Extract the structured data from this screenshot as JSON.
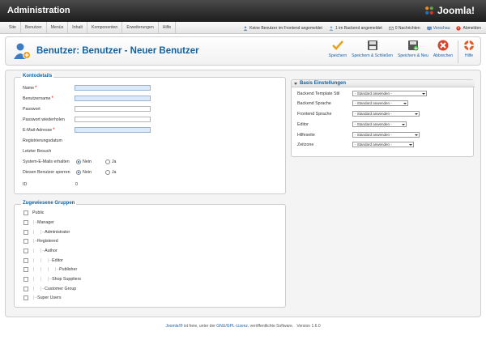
{
  "header": {
    "title": "Administration",
    "logo_text": "Joomla!"
  },
  "menu": [
    "Site",
    "Benutzer",
    "Menüs",
    "Inhalt",
    "Komponenten",
    "Erweiterungen",
    "Hilfe"
  ],
  "status": {
    "frontend": "Keine Benutzer im Frontend angemeldet",
    "backend": "1 im Backend angemeldet",
    "messages": "0 Nachrichten",
    "preview": "Vorschau",
    "logout": "Abmelden"
  },
  "toolbar": {
    "title": "Benutzer: Benutzer - Neuer Benutzer",
    "save": "Speichern",
    "save_close": "Speichern & Schließen",
    "save_new": "Speichern & Neu",
    "cancel": "Abbrechen",
    "help": "Hilfe"
  },
  "account": {
    "legend": "Kontodetails",
    "name": "Name",
    "username": "Benutzername",
    "password": "Passwort",
    "password2": "Passwort wiederholen",
    "email": "E-Mail-Adresse",
    "register_date": "Registrierungsdatum",
    "last_visit": "Letzter Besuch",
    "system_mails": "System-E-Mails erhalten",
    "block_user": "Diesen Benutzer sperren",
    "no": "Nein",
    "yes": "Ja",
    "id_label": "ID",
    "id_value": "0"
  },
  "groups": {
    "legend": "Zugewiesene Gruppen",
    "items": [
      {
        "label": "Public",
        "prefix": ""
      },
      {
        "label": "Manager",
        "prefix": "|—"
      },
      {
        "label": "Administrator",
        "prefix": "|  |—"
      },
      {
        "label": "Registered",
        "prefix": "|—"
      },
      {
        "label": "Author",
        "prefix": "|  |—"
      },
      {
        "label": "Editor",
        "prefix": "|  |  |—"
      },
      {
        "label": "Publisher",
        "prefix": "|  |  |  |—"
      },
      {
        "label": "Shop Suppliers",
        "prefix": "|  |  |—"
      },
      {
        "label": "Customer Group",
        "prefix": "|  |—"
      },
      {
        "label": "Super Users",
        "prefix": "|—"
      }
    ]
  },
  "basis": {
    "legend": "Basis Einstellungen",
    "rows": [
      {
        "label": "Backend Template Stil",
        "value": "- Standard anwenden -"
      },
      {
        "label": "Backend Sprache",
        "value": "- Standard anwenden -"
      },
      {
        "label": "Frontend Sprache",
        "value": "- Standard anwenden -"
      },
      {
        "label": "Editor",
        "value": "- Standard anwenden -"
      },
      {
        "label": "Hilfeseite",
        "value": "- Standard anwenden -"
      },
      {
        "label": "Zeitzone",
        "value": "- Standard anwenden -"
      }
    ]
  },
  "footer": {
    "brand": "Joomla!®",
    "text1": " ist freie, unter der ",
    "license": "GNU/GPL-Lizenz",
    "text2": ", veröffentlichte Software.",
    "version": "Version 1.6.0"
  },
  "colors": {
    "accent": "#14609c",
    "required_field": "#dbe9f8",
    "save": "#e8a11a",
    "cancel": "#d9432a",
    "help": "#e05a24"
  }
}
